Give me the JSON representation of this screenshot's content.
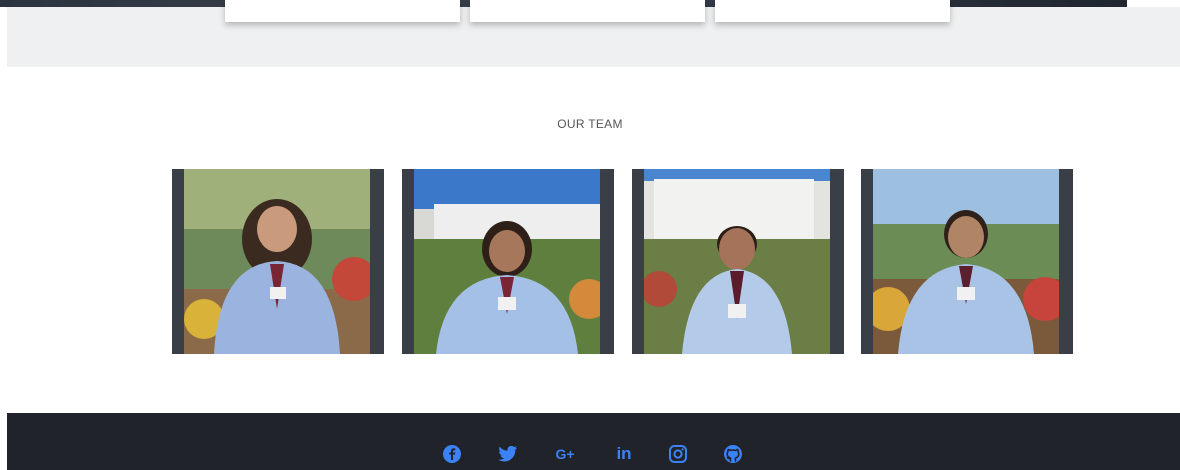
{
  "section": {
    "title": "OUR TEAM"
  },
  "team": [
    {
      "id": "member-1"
    },
    {
      "id": "member-2"
    },
    {
      "id": "member-3"
    },
    {
      "id": "member-4"
    }
  ],
  "footer": {
    "social_icons": [
      "facebook-icon",
      "twitter-icon",
      "google-plus-icon",
      "linkedin-icon",
      "instagram-icon",
      "github-icon"
    ],
    "google_plus_text": "G+",
    "linkedin_text": "in"
  },
  "colors": {
    "footer_bg": "#20232a",
    "icon_accent": "#3b82f6",
    "card_frame": "#3a3f47"
  }
}
